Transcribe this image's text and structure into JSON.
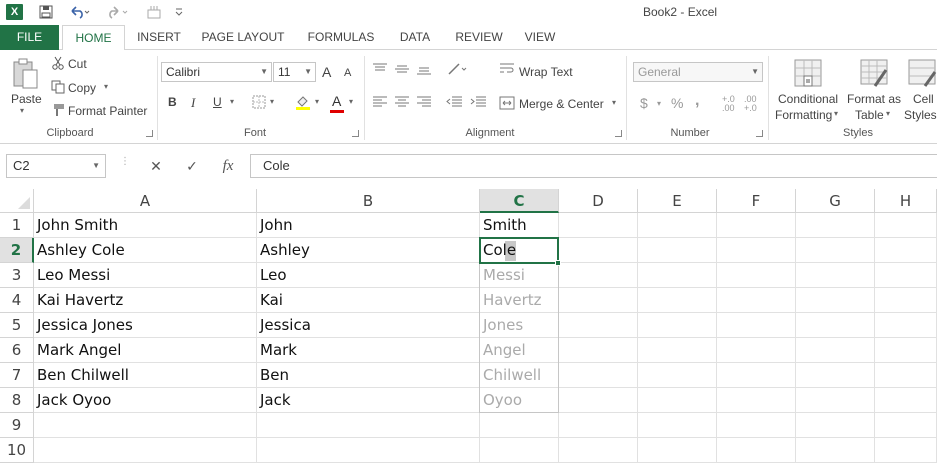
{
  "app": {
    "logo": "X",
    "window_title": "Book2 - Excel",
    "quick_access": [
      "save-icon",
      "undo-icon",
      "redo-icon",
      "touch-mode-icon",
      "customize-icon"
    ]
  },
  "tabs": [
    {
      "label": "FILE"
    },
    {
      "label": "HOME"
    },
    {
      "label": "INSERT"
    },
    {
      "label": "PAGE LAYOUT"
    },
    {
      "label": "FORMULAS"
    },
    {
      "label": "DATA"
    },
    {
      "label": "REVIEW"
    },
    {
      "label": "VIEW"
    }
  ],
  "clipboard": {
    "paste": "Paste",
    "cut": "Cut",
    "copy": "Copy",
    "format_painter": "Format Painter",
    "group": "Clipboard"
  },
  "font": {
    "family": "Calibri",
    "size": "11",
    "bold": "B",
    "italic": "I",
    "underline": "U",
    "grow": "A",
    "shrink": "A",
    "color": "A",
    "group": "Font"
  },
  "alignment": {
    "wrap_text": "Wrap Text",
    "merge_center": "Merge & Center",
    "group": "Alignment"
  },
  "number": {
    "format": "General",
    "currency": "$",
    "percent": "%",
    "comma": ",",
    "inc_decimal": "+.0 .00",
    "dec_decimal": ".00 +.0",
    "group": "Number"
  },
  "styles": {
    "conditional_formatting_1": "Conditional",
    "conditional_formatting_2": "Formatting",
    "format_as_table_1": "Format as",
    "format_as_table_2": "Table",
    "cell_styles_1": "Cell",
    "cell_styles_2": "Styles",
    "group": "Styles"
  },
  "formula_bar": {
    "name_box": "C2",
    "cancel": "✕",
    "enter": "✓",
    "fx": "fx",
    "content": "Cole"
  },
  "columns": [
    "A",
    "B",
    "C",
    "D",
    "E",
    "F",
    "G",
    "H"
  ],
  "rows": [
    "1",
    "2",
    "3",
    "4",
    "5",
    "6",
    "7",
    "8",
    "9",
    "10"
  ],
  "cells": {
    "A": [
      "John Smith",
      "Ashley Cole",
      "Leo Messi",
      "Kai Havertz",
      "Jessica Jones",
      "Mark Angel",
      "Ben Chilwell",
      "Jack Oyoo"
    ],
    "B": [
      "John",
      "Ashley",
      "Leo",
      "Kai",
      "Jessica",
      "Mark",
      "Ben",
      "Jack"
    ],
    "C": [
      "Smith",
      "Cole"
    ]
  },
  "flash_fill_preview": [
    "Messi",
    "Havertz",
    "Jones",
    "Angel",
    "Chilwell",
    "Oyoo"
  ],
  "selection": {
    "column": "C",
    "row": "2"
  },
  "colors": {
    "accent": "#217346",
    "ghost_text": "#aaaaaa"
  }
}
